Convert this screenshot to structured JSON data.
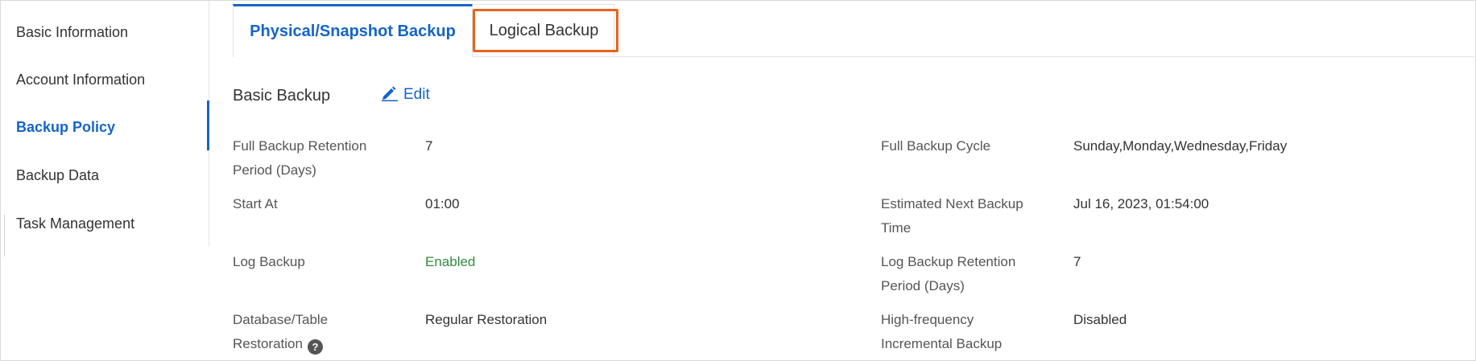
{
  "sidebar": {
    "items": [
      {
        "label": "Basic Information"
      },
      {
        "label": "Account Information"
      },
      {
        "label": "Backup Policy"
      },
      {
        "label": "Backup Data"
      },
      {
        "label": "Task Management"
      }
    ]
  },
  "tabs": [
    {
      "label": "Physical/Snapshot Backup",
      "active": true
    },
    {
      "label": "Logical Backup",
      "active": false
    }
  ],
  "section": {
    "title": "Basic Backup",
    "edit_label": "Edit"
  },
  "fields": {
    "full_retention": {
      "label": "Full Backup Retention Period (Days)",
      "value": "7"
    },
    "full_cycle": {
      "label": "Full Backup Cycle",
      "value": "Sunday,Monday,Wednesday,Friday"
    },
    "start_at": {
      "label": "Start At",
      "value": "01:00"
    },
    "next_backup": {
      "label": "Estimated Next Backup Time",
      "value": "Jul 16, 2023, 01:54:00"
    },
    "log_backup": {
      "label": "Log Backup",
      "value": "Enabled"
    },
    "log_retention": {
      "label": "Log Backup Retention Period (Days)",
      "value": "7"
    },
    "db_restoration": {
      "label": "Database/Table Restoration",
      "value": "Regular Restoration"
    },
    "hf_incremental": {
      "label": "High-frequency Incremental Backup",
      "value": "Disabled"
    }
  },
  "colors": {
    "accent": "#1464c8",
    "highlight": "#e8641b",
    "enabled": "#2e8b3e"
  }
}
